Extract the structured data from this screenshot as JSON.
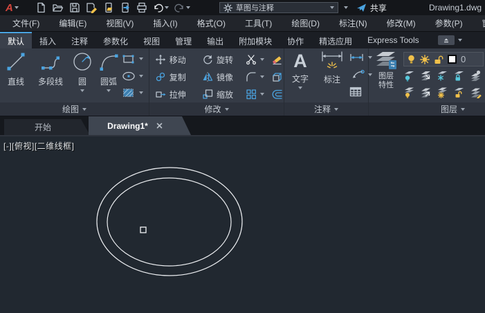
{
  "titlebar": {
    "logo": "A",
    "workspace": "草图与注释",
    "share_label": "共享",
    "doc_title": "Drawing1.dwg"
  },
  "menubar": {
    "items": [
      "文件(F)",
      "编辑(E)",
      "视图(V)",
      "插入(I)",
      "格式(O)",
      "工具(T)",
      "绘图(D)",
      "标注(N)",
      "修改(M)",
      "参数(P)",
      "窗口(W)"
    ]
  },
  "ribbon": {
    "tabs": [
      "默认",
      "插入",
      "注释",
      "参数化",
      "视图",
      "管理",
      "输出",
      "附加模块",
      "协作",
      "精选应用",
      "Express Tools"
    ],
    "active_tab": "默认",
    "panels": {
      "draw": {
        "title": "绘图",
        "line": "直线",
        "polyline": "多段线",
        "circle": "圆",
        "arc": "圆弧"
      },
      "modify": {
        "title": "修改",
        "move": "移动",
        "rotate": "旋转",
        "copy": "复制",
        "mirror": "镜像",
        "stretch": "拉伸",
        "scale": "缩放"
      },
      "annotate": {
        "title": "注释",
        "text": "文字",
        "text_glyph": "A",
        "dimension": "标注"
      },
      "layers": {
        "title": "图层",
        "properties": "图层特性",
        "current_layer": "0"
      }
    }
  },
  "filetabs": {
    "start": "开始",
    "drawing": "Drawing1*"
  },
  "canvas": {
    "viewport_label": "[-][俯视][二维线框]"
  },
  "colors": {
    "accent_blue": "#4aa3e0",
    "icon_yellow": "#f0c04a",
    "canvas_bg": "#212830",
    "ribbon_bg": "#353b46"
  }
}
